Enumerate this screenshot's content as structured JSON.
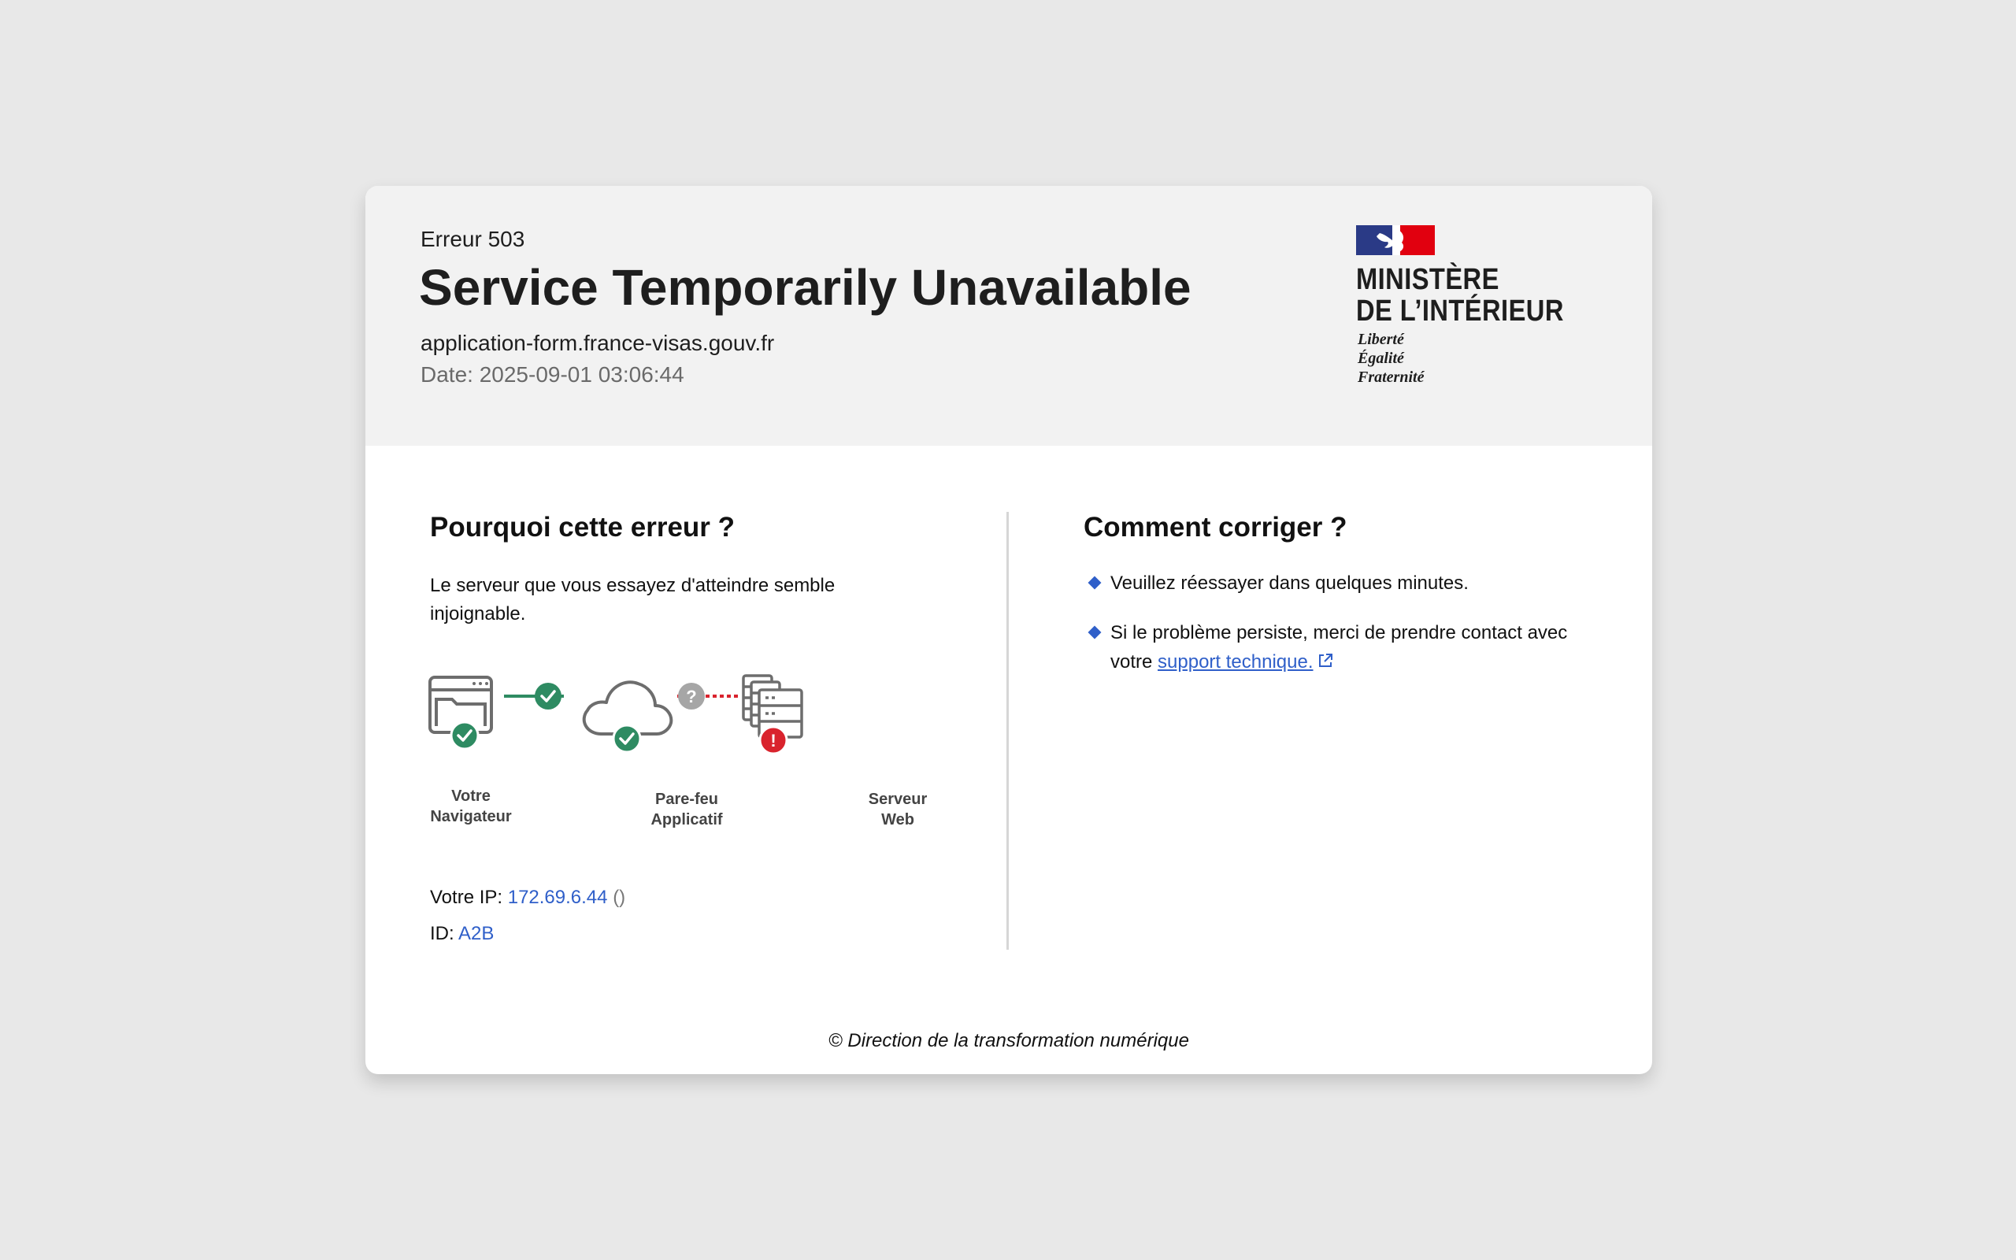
{
  "header": {
    "error_code": "Erreur 503",
    "title": "Service Temporarily Unavailable",
    "host": "application-form.france-visas.gouv.fr",
    "date": "Date: 2025-09-01 03:06:44"
  },
  "logo": {
    "line1": "MINISTÈRE",
    "line2": "DE L’INTÉRIEUR",
    "motto": [
      "Liberté",
      "Égalité",
      "Fraternité"
    ],
    "colors": {
      "blue": "#2a3a86",
      "red": "#e1000f"
    }
  },
  "why": {
    "heading": "Pourquoi cette erreur ?",
    "text": "Le serveur que vous essayez d'atteindre semble injoignable.",
    "diagram": {
      "nodes": [
        {
          "label_1": "Votre",
          "label_2": "Navigateur",
          "icon": "browser-window-icon",
          "status": "ok"
        },
        {
          "label_1": "Pare-feu",
          "label_2": "Applicatif",
          "icon": "cloud-icon",
          "status": "ok"
        },
        {
          "label_1": "Serveur",
          "label_2": "Web",
          "icon": "server-stack-icon",
          "status": "error"
        }
      ],
      "links": [
        {
          "status": "ok"
        },
        {
          "status": "unknown"
        }
      ]
    },
    "ip_label": "Votre IP: ",
    "ip_value": "172.69.6.44",
    "ip_extra": "()",
    "id_label": "ID: ",
    "id_value": "A2B"
  },
  "fix": {
    "heading": "Comment corriger ?",
    "tip1": "Veuillez réessayer dans quelques minutes.",
    "tip2_text": "Si le problème persiste, merci de prendre contact avec votre ",
    "tip2_link": "support technique."
  },
  "footer": "© Direction de la transformation numérique",
  "colors": {
    "ok": "#2e8b62",
    "error": "#d9232d",
    "unknown": "#a6a6a6",
    "link": "#2f5fc9",
    "icon_grey": "#6d6d6d"
  }
}
